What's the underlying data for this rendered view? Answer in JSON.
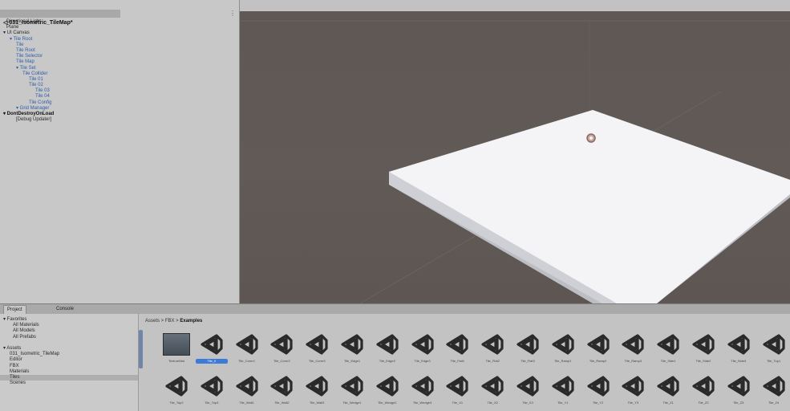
{
  "hierarchy": {
    "scene_title": "◁ 031_Isometric_TileMap*",
    "menu_icon": "⋮",
    "rows": [
      {
        "text": "Directional Light",
        "indent": 8,
        "cls": ""
      },
      {
        "text": "Plane",
        "indent": 8,
        "cls": ""
      },
      {
        "text": "▾ UI Canvas",
        "indent": 4,
        "cls": ""
      },
      {
        "text": "▾ Tile Root",
        "indent": 12,
        "cls": "blue"
      },
      {
        "text": "Tile",
        "indent": 20,
        "cls": "blue"
      },
      {
        "text": "Tile Root",
        "indent": 20,
        "cls": "blue"
      },
      {
        "text": "Tile Selector",
        "indent": 20,
        "cls": "blue"
      },
      {
        "text": "Tile Map",
        "indent": 20,
        "cls": "blue"
      },
      {
        "text": "▾ Tile Set",
        "indent": 20,
        "cls": "blue"
      },
      {
        "text": "Tile Collider",
        "indent": 28,
        "cls": "blue"
      },
      {
        "text": "Tile 01",
        "indent": 36,
        "cls": "blue"
      },
      {
        "text": "Tile 02",
        "indent": 36,
        "cls": "blue"
      },
      {
        "text": "Tile 03",
        "indent": 44,
        "cls": "blue"
      },
      {
        "text": "Tile 04",
        "indent": 44,
        "cls": "blue"
      },
      {
        "text": "Tile Config",
        "indent": 36,
        "cls": "blue"
      },
      {
        "text": "▾ Grid Manager",
        "indent": 20,
        "cls": "blue"
      },
      {
        "text": "▾ DontDestroyOnLoad",
        "indent": 4,
        "cls": "scene"
      },
      {
        "text": "[Debug Updater]",
        "indent": 20,
        "cls": ""
      }
    ]
  },
  "project": {
    "tabs": [
      "Project",
      "Console"
    ],
    "tree": [
      {
        "text": "▾ Favorites",
        "indent": 0,
        "sel": false
      },
      {
        "text": "All Materials",
        "indent": 12,
        "sel": false
      },
      {
        "text": "All Models",
        "indent": 12,
        "sel": false
      },
      {
        "text": "All Prefabs",
        "indent": 12,
        "sel": false
      },
      {
        "text": "",
        "indent": 0,
        "sel": false
      },
      {
        "text": "▾ Assets",
        "indent": 0,
        "sel": false
      },
      {
        "text": "031_Isometric_TileMap",
        "indent": 8,
        "sel": false
      },
      {
        "text": "Editor",
        "indent": 8,
        "sel": false
      },
      {
        "text": "FBX",
        "indent": 8,
        "sel": false
      },
      {
        "text": "Materials",
        "indent": 8,
        "sel": false
      },
      {
        "text": "Tiles",
        "indent": 8,
        "sel": true
      },
      {
        "text": "Scenes",
        "indent": 8,
        "sel": false
      }
    ],
    "breadcrumb_prefix": "Assets > FBX > ",
    "breadcrumb_current": "Examples",
    "assets_row1": [
      "TextureMat",
      "Tile_0",
      "Tile_Cornr1",
      "Tile_Cornr2",
      "Tile_Cornr3",
      "Tile_Edge1",
      "Tile_Edge2",
      "Tile_Edge3",
      "Tile_Flat1",
      "Tile_Flat2",
      "Tile_Flat3",
      "Tile_Ramp1",
      "Tile_Ramp2",
      "Tile_Ramp3",
      "Tile_Side1",
      "Tile_Side2",
      "Tile_Side3",
      "Tile_Top1"
    ],
    "assets_row2": [
      "Tile_Top2",
      "Tile_Top3",
      "Tile_Wall1",
      "Tile_Wall2",
      "Tile_Wall3",
      "Tile_Wedge1",
      "Tile_Wedge2",
      "Tile_Wedge3",
      "Tile_X1",
      "Tile_X2",
      "Tile_X3",
      "Tile_Y1",
      "Tile_Y2",
      "Tile_Y3",
      "Tile_Z1",
      "Tile_Z2",
      "Tile_Z3",
      "Tile_Z4"
    ],
    "selected_index": 1
  },
  "colors": {
    "selection": "#3d7bd8",
    "unity_icon": "#2a2a2a",
    "viewport": "#5f5854",
    "tile": "#f4f4f6"
  },
  "icons": {
    "unity_logo": "unity-logo-icon",
    "material": "material-swatch-icon"
  }
}
